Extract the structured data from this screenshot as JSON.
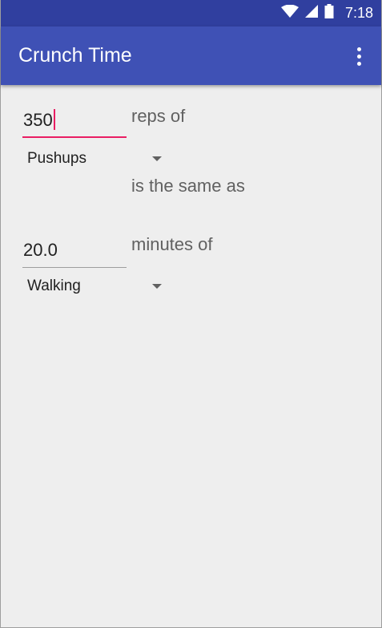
{
  "status_bar": {
    "time": "7:18",
    "icons": [
      "wifi-icon",
      "signal-icon",
      "battery-icon"
    ]
  },
  "app_bar": {
    "title": "Crunch Time",
    "overflow_icon": "more-vert-icon"
  },
  "converter": {
    "reps_value": "350",
    "reps_label": "reps of",
    "exercise1": "Pushups",
    "equivalence_label": "is the same as",
    "minutes_value": "20.0",
    "minutes_label": "minutes of",
    "exercise2": "Walking"
  },
  "colors": {
    "status_bar": "#303f9f",
    "app_bar": "#3f51b5",
    "accent": "#e91e63",
    "background": "#eeeeee"
  }
}
